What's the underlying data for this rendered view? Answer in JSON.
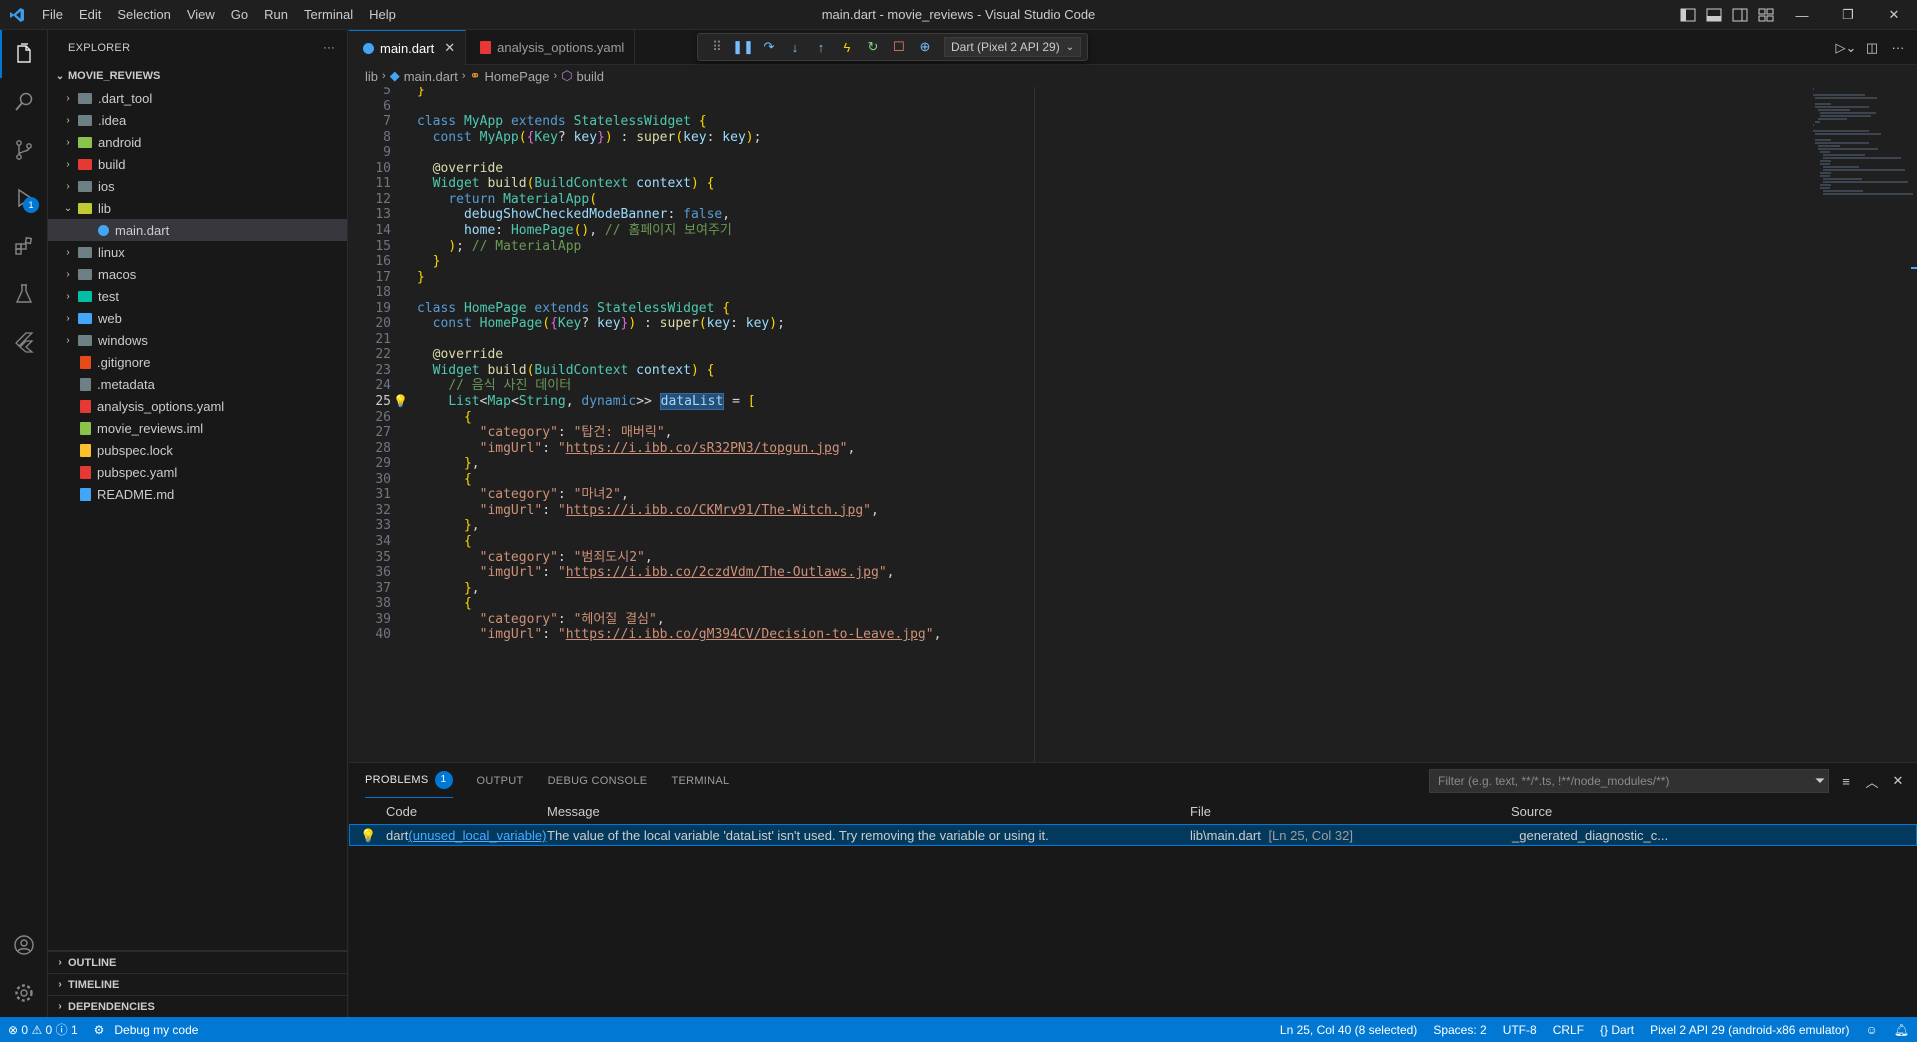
{
  "window": {
    "title": "main.dart - movie_reviews - Visual Studio Code"
  },
  "menu": [
    "File",
    "Edit",
    "Selection",
    "View",
    "Go",
    "Run",
    "Terminal",
    "Help"
  ],
  "sidebar": {
    "header": "EXPLORER",
    "more": "···",
    "root": "MOVIE_REVIEWS",
    "items": [
      {
        "label": ".dart_tool",
        "type": "folder",
        "color": "#6d8086"
      },
      {
        "label": ".idea",
        "type": "folder",
        "color": "#6d8086"
      },
      {
        "label": "android",
        "type": "folder",
        "color": "#8bc34a"
      },
      {
        "label": "build",
        "type": "folder",
        "color": "#e53935"
      },
      {
        "label": "ios",
        "type": "folder",
        "color": "#6d8086"
      },
      {
        "label": "lib",
        "type": "folder-open",
        "color": "#c0ca33"
      },
      {
        "label": "main.dart",
        "type": "dart",
        "color": "#42a5f5"
      },
      {
        "label": "linux",
        "type": "folder",
        "color": "#6d8086"
      },
      {
        "label": "macos",
        "type": "folder",
        "color": "#6d8086"
      },
      {
        "label": "test",
        "type": "folder",
        "color": "#00bfa5"
      },
      {
        "label": "web",
        "type": "folder",
        "color": "#42a5f5"
      },
      {
        "label": "windows",
        "type": "folder",
        "color": "#6d8086"
      },
      {
        "label": ".gitignore",
        "type": "file",
        "color": "#e64a19"
      },
      {
        "label": ".metadata",
        "type": "file",
        "color": "#6d8086"
      },
      {
        "label": "analysis_options.yaml",
        "type": "file",
        "color": "#e53935"
      },
      {
        "label": "movie_reviews.iml",
        "type": "file",
        "color": "#8bc34a"
      },
      {
        "label": "pubspec.lock",
        "type": "file",
        "color": "#fbc02d"
      },
      {
        "label": "pubspec.yaml",
        "type": "file",
        "color": "#e53935"
      },
      {
        "label": "README.md",
        "type": "file",
        "color": "#42a5f5"
      }
    ],
    "outline": "OUTLINE",
    "timeline": "TIMELINE",
    "dependencies": "DEPENDENCIES"
  },
  "tabs": [
    {
      "label": "main.dart",
      "active": true,
      "close": "✕"
    },
    {
      "label": "analysis_options.yaml",
      "active": false
    }
  ],
  "debug": {
    "device": "Dart (Pixel 2 API 29)"
  },
  "breadcrumb": [
    "lib",
    "main.dart",
    "HomePage",
    "build"
  ],
  "panel": {
    "tabs": [
      "PROBLEMS",
      "OUTPUT",
      "DEBUG CONSOLE",
      "TERMINAL"
    ],
    "problem_count": "1",
    "filter_placeholder": "Filter (e.g. text, **/*.ts, !**/node_modules/**)",
    "columns": [
      "Code",
      "Message",
      "File",
      "Source"
    ],
    "row": {
      "code_prefix": "dart",
      "code_link": "(unused_local_variable)",
      "message": "The value of the local variable 'dataList' isn't used. Try removing the variable or using it.",
      "file": "lib\\main.dart",
      "location": "[Ln 25, Col 32]",
      "source": "_generated_diagnostic_c..."
    }
  },
  "statusbar": {
    "errors": "0",
    "warnings": "0",
    "infos": "1",
    "debug": "Debug my code",
    "cursor": "Ln 25, Col 40 (8 selected)",
    "spaces": "Spaces: 2",
    "encoding": "UTF-8",
    "eol": "CRLF",
    "language": "{} Dart",
    "device": "Pixel 2 API 29 (android-x86 emulator)"
  },
  "code": {
    "current_line": 25,
    "lines": [
      {
        "n": 5,
        "t": "}"
      },
      {
        "n": 6,
        "t": ""
      },
      {
        "n": 7,
        "t": "class MyApp extends StatelessWidget {"
      },
      {
        "n": 8,
        "t": "  const MyApp({Key? key}) : super(key: key);"
      },
      {
        "n": 9,
        "t": ""
      },
      {
        "n": 10,
        "t": "  @override"
      },
      {
        "n": 11,
        "t": "  Widget build(BuildContext context) {"
      },
      {
        "n": 12,
        "t": "    return MaterialApp("
      },
      {
        "n": 13,
        "t": "      debugShowCheckedModeBanner: false,"
      },
      {
        "n": 14,
        "t": "      home: HomePage(), // 홈페이지 보여주기"
      },
      {
        "n": 15,
        "t": "    ); // MaterialApp"
      },
      {
        "n": 16,
        "t": "  }"
      },
      {
        "n": 17,
        "t": "}"
      },
      {
        "n": 18,
        "t": ""
      },
      {
        "n": 19,
        "t": "class HomePage extends StatelessWidget {"
      },
      {
        "n": 20,
        "t": "  const HomePage({Key? key}) : super(key: key);"
      },
      {
        "n": 21,
        "t": ""
      },
      {
        "n": 22,
        "t": "  @override"
      },
      {
        "n": 23,
        "t": "  Widget build(BuildContext context) {"
      },
      {
        "n": 24,
        "t": "    // 음식 사진 데이터"
      },
      {
        "n": 25,
        "t": "    List<Map<String, dynamic>> dataList = ["
      },
      {
        "n": 26,
        "t": "      {"
      },
      {
        "n": 27,
        "t": "        \"category\": \"탑건: 매버릭\","
      },
      {
        "n": 28,
        "t": "        \"imgUrl\": \"https://i.ibb.co/sR32PN3/topgun.jpg\","
      },
      {
        "n": 29,
        "t": "      },"
      },
      {
        "n": 30,
        "t": "      {"
      },
      {
        "n": 31,
        "t": "        \"category\": \"마녀2\","
      },
      {
        "n": 32,
        "t": "        \"imgUrl\": \"https://i.ibb.co/CKMrv91/The-Witch.jpg\","
      },
      {
        "n": 33,
        "t": "      },"
      },
      {
        "n": 34,
        "t": "      {"
      },
      {
        "n": 35,
        "t": "        \"category\": \"범죄도시2\","
      },
      {
        "n": 36,
        "t": "        \"imgUrl\": \"https://i.ibb.co/2czdVdm/The-Outlaws.jpg\","
      },
      {
        "n": 37,
        "t": "      },"
      },
      {
        "n": 38,
        "t": "      {"
      },
      {
        "n": 39,
        "t": "        \"category\": \"헤어질 결심\","
      },
      {
        "n": 40,
        "t": "        \"imgUrl\": \"https://i.ibb.co/gM394CV/Decision-to-Leave.jpg\","
      }
    ]
  },
  "colors": {
    "accent": "#0078d4",
    "background": "#1f1f1f",
    "sidebar": "#181818"
  }
}
